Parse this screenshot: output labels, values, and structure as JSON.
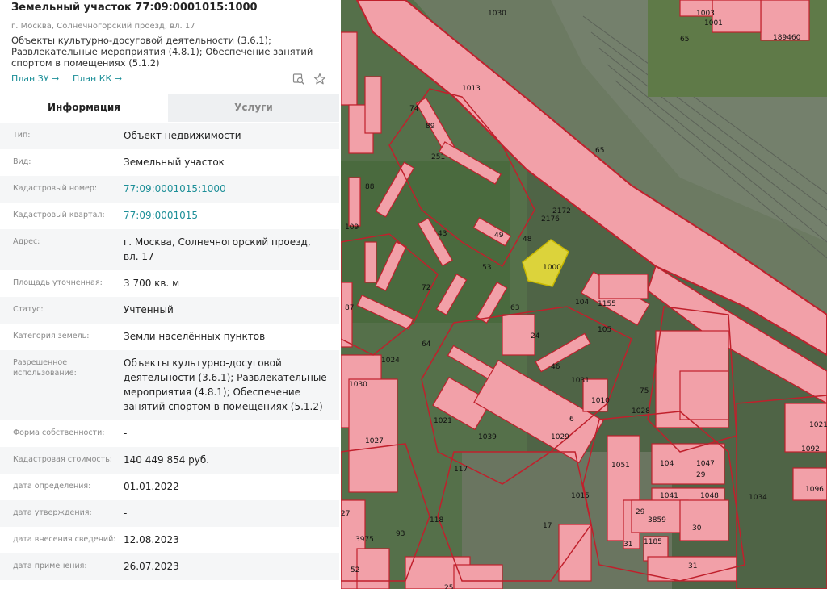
{
  "header": {
    "title": "Земельный участок 77:09:0001015:1000",
    "address_small": "г. Москва, Солнечногорский проезд, вл. 17",
    "description": [
      "Объекты культурно-досуговой деятельности (3.6.1);",
      "Развлекательные мероприятия (4.8.1); Обеспечение занятий",
      "спортом в помещениях (5.1.2)"
    ],
    "link_plan_zu": "План ЗУ →",
    "link_plan_kk": "План КК →"
  },
  "tabs": {
    "info": "Информация",
    "services": "Услуги"
  },
  "rows": [
    {
      "label": "Тип:",
      "value": [
        "Объект недвижимости"
      ]
    },
    {
      "label": "Вид:",
      "value": [
        "Земельный участок"
      ]
    },
    {
      "label": "Кадастровый номер:",
      "value": [
        "77:09:0001015:1000"
      ]
    },
    {
      "label": "Кадастровый квартал:",
      "value": [
        "77:09:0001015"
      ]
    },
    {
      "label": "Адрес:",
      "value": [
        "г. Москва, Солнечногорский проезд,",
        "вл. 17"
      ]
    },
    {
      "label": "Площадь уточненная:",
      "value": [
        "3 700 кв. м"
      ]
    },
    {
      "label": "Статус:",
      "value": [
        "Учтенный"
      ]
    },
    {
      "label": "Категория земель:",
      "value": [
        "Земли населённых пунктов"
      ]
    },
    {
      "label": "Разрешенное использование:",
      "value": [
        "Объекты культурно-досуговой",
        "деятельности (3.6.1); Развлекательные",
        "мероприятия (4.8.1); Обеспечение",
        "занятий спортом в помещениях (5.1.2)"
      ]
    },
    {
      "label": "Форма собственности:",
      "value": [
        "-"
      ]
    },
    {
      "label": "Кадастровая стоимость:",
      "value": [
        "140 449 854 руб."
      ]
    },
    {
      "label": "дата определения:",
      "value": [
        "01.01.2022"
      ]
    },
    {
      "label": "дата утверждения:",
      "value": [
        "-"
      ]
    },
    {
      "label": "дата внесения сведений:",
      "value": [
        "12.08.2023"
      ]
    },
    {
      "label": "дата применения:",
      "value": [
        "26.07.2023"
      ]
    }
  ],
  "map": {
    "labels": [
      "1030",
      "1013",
      "74",
      "89",
      "251",
      "2172",
      "2176",
      "65",
      "88",
      "49",
      "48",
      "43",
      "1000",
      "53",
      "72",
      "63",
      "1155",
      "104",
      "105",
      "109",
      "87",
      "64",
      "1024",
      "1030",
      "24",
      "46",
      "1031",
      "1010",
      "75",
      "1028",
      "1021",
      "1039",
      "1029",
      "6",
      "1027",
      "117",
      "1051",
      "1047",
      "29",
      "1048",
      "104",
      "1041",
      "1015",
      "118",
      "17",
      "3859",
      "30",
      "29",
      "1185",
      "31",
      "27",
      "93",
      "3975",
      "52",
      "25",
      "31",
      "1001",
      "1003",
      "65",
      "189460",
      "1021",
      "1092",
      "1096",
      "1034"
    ],
    "colors": {
      "parcel_fill": "#f2a0a8",
      "parcel_stroke": "#c0202c",
      "highlight": "#f5e63a"
    }
  },
  "icons": {
    "search_map": "search-map-icon",
    "star": "star-icon"
  }
}
